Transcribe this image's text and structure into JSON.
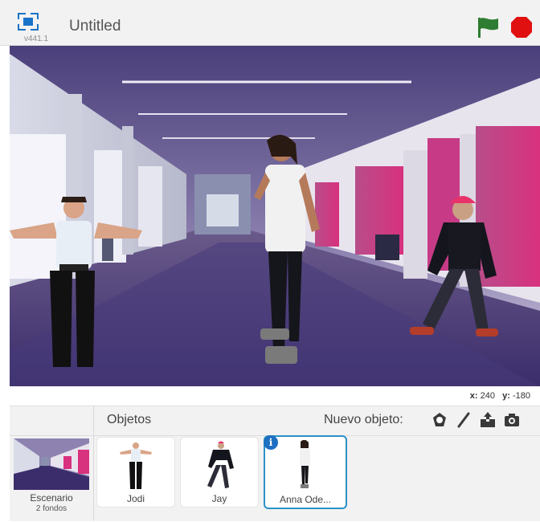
{
  "header": {
    "title": "Untitled",
    "version": "v441.1"
  },
  "stage": {
    "coords_x_label": "x:",
    "coords_x": "240",
    "coords_y_label": "y:",
    "coords_y": "-180"
  },
  "sprites_panel": {
    "objects_label": "Objetos",
    "new_object_label": "Nuevo objeto:",
    "tools": [
      "paint-sprite-library-icon",
      "paintbrush-icon",
      "upload-icon",
      "camera-icon"
    ]
  },
  "stage_thumb": {
    "name": "Escenario",
    "backdrops": "2 fondos"
  },
  "sprites": [
    {
      "name": "Jodi"
    },
    {
      "name": "Jay"
    },
    {
      "name": "Anna Ode..."
    }
  ],
  "colors": {
    "flag": "#2e7d32",
    "stop": "#e01010",
    "accent": "#1d6fc1"
  }
}
